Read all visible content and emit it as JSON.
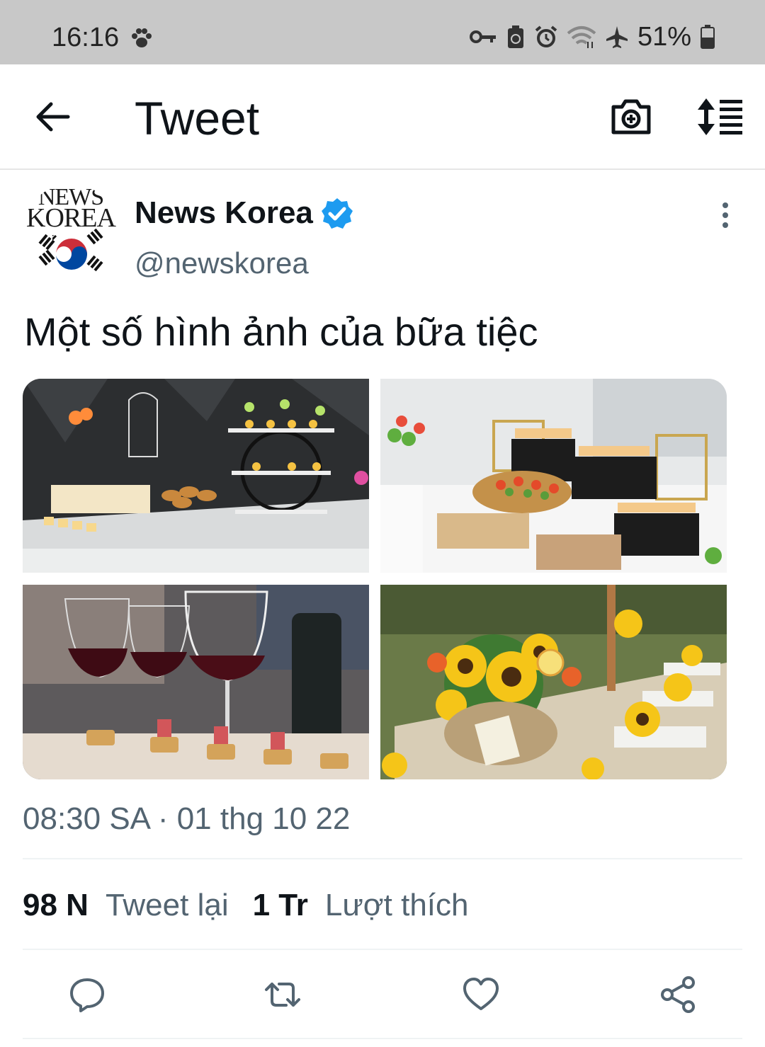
{
  "status_bar": {
    "time": "16:16",
    "battery_percent": "51%",
    "icons": [
      "paw-icon",
      "vpn-key-icon",
      "recycle-icon",
      "alarm-icon",
      "wifi-icon",
      "airplane-icon",
      "battery-icon"
    ]
  },
  "header": {
    "title": "Tweet",
    "icons": [
      "back-arrow-icon",
      "camera-add-icon",
      "sort-icon"
    ]
  },
  "tweet": {
    "author": {
      "name": "News Korea",
      "handle": "@newskorea",
      "verified": true,
      "avatar_text_line1": "NEWS",
      "avatar_text_line2": "KOREA"
    },
    "text": "Một số hình ảnh của bữa tiệc",
    "photos": [
      {
        "name": "party-buffet-dessert-photo"
      },
      {
        "name": "party-sushi-table-photo"
      },
      {
        "name": "wine-glasses-canapes-photo"
      },
      {
        "name": "sunflower-table-decor-photo"
      }
    ],
    "timestamp": "08:30 SA · 01 thg 10 22",
    "retweets": {
      "count": "98 N",
      "label": "Tweet lại"
    },
    "likes": {
      "count": "1 Tr",
      "label": "Lượt thích"
    },
    "actions": [
      "reply-icon",
      "retweet-icon",
      "like-icon",
      "share-icon"
    ]
  },
  "colors": {
    "status_bar_bg": "#c8c8c8",
    "verified_blue": "#1d9bf0",
    "secondary_text": "#536471",
    "primary_text": "#0f1419"
  }
}
